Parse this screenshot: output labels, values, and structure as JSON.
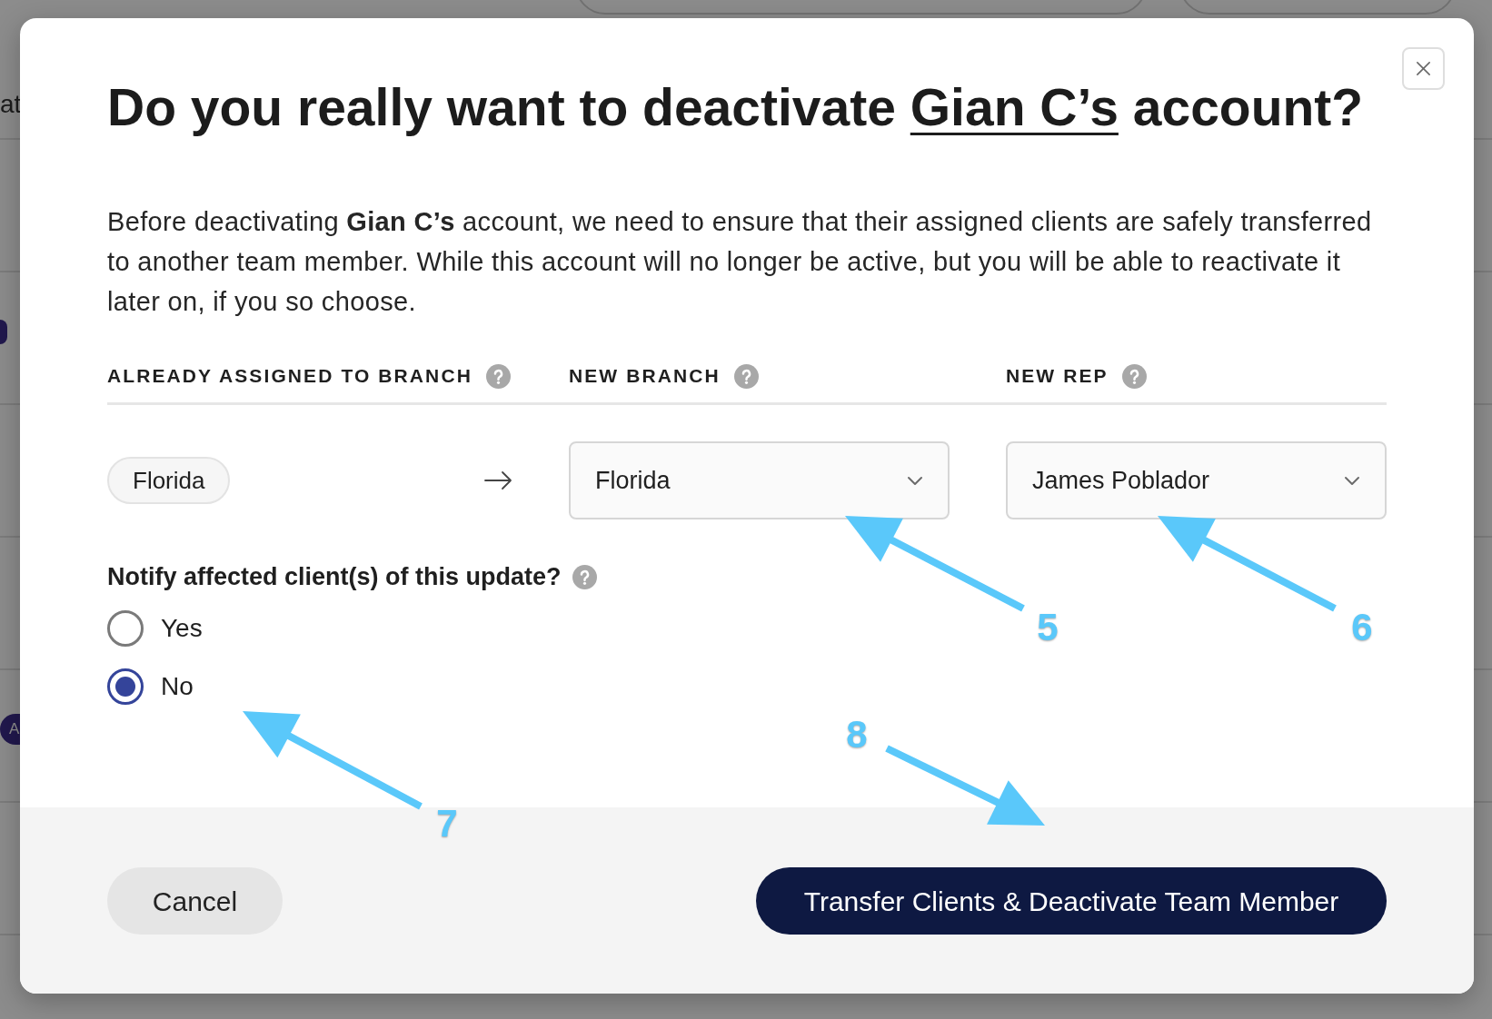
{
  "background_page": {
    "list_text": "at",
    "avatar_initial": "A"
  },
  "dialog": {
    "title": {
      "text_before": "Do you really want to deactivate ",
      "link": "Gian C’s",
      "text_after": " account?"
    },
    "description": "Before deactivating **Gian C’s** account, we need to ensure that their assigned clients are safely transferred to another team member. While this account will no longer be active, but you will be able to reactivate it later on, if you so choose.",
    "columns": [
      {
        "label": "ALREADY ASSIGNED TO BRANCH"
      },
      {
        "label": "NEW BRANCH"
      },
      {
        "label": "NEW REP"
      }
    ],
    "assignment": {
      "current_branch": "Florida",
      "new_branch": {
        "value": "Florida"
      },
      "new_rep": {
        "value": "James Poblador"
      }
    },
    "notify": {
      "question": "Notify affected client(s) of this update?",
      "options": [
        {
          "label": "Yes",
          "selected": false
        },
        {
          "label": "No",
          "selected": true
        }
      ]
    },
    "buttons": [
      {
        "label": "Cancel",
        "kind": "secondary"
      },
      {
        "label": "Transfer Clients & Deactivate Team Member",
        "kind": "primary"
      }
    ]
  },
  "annotations": [
    {
      "label": "5"
    },
    {
      "label": "6"
    },
    {
      "label": "7"
    },
    {
      "label": "8"
    }
  ]
}
